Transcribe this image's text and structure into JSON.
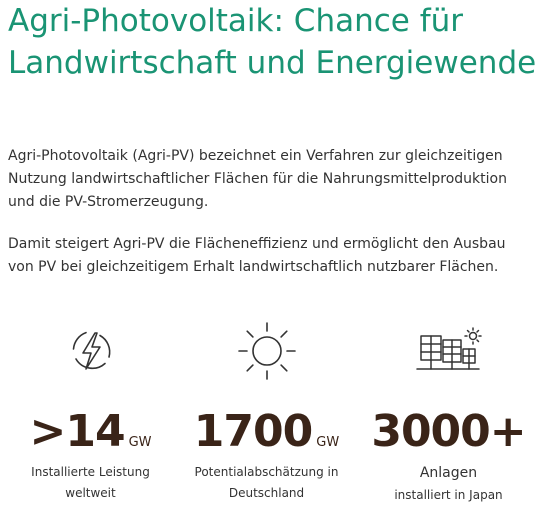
{
  "heading": {
    "title": "Agri-Photovoltaik: Chance für Landwirtschaft und Energiewende"
  },
  "intro": {
    "paragraph1": "Agri-Photovoltaik (Agri-PV) bezeichnet ein Verfahren zur gleichzeitigen Nutzung landwirtschaftlicher Flächen für die Nahrungsmittelproduktion und die PV-Stromerzeugung.",
    "paragraph2": "Damit steigert Agri-PV die Flächeneffizienz und ermöglicht den Ausbau von PV bei gleichzeitigem Erhalt landwirtschaftlich nutzbarer Flächen."
  },
  "stats": [
    {
      "icon": "lightning-circle-icon",
      "value": ">14",
      "unit": "GW",
      "caption_line1": "Installierte Leistung",
      "caption_line2": "weltweit"
    },
    {
      "icon": "sun-icon",
      "value": "1700",
      "unit": "GW",
      "caption_line1": "Potentialabschätzung in",
      "caption_line2": "Deutschland"
    },
    {
      "icon": "solar-panels-sun-icon",
      "value": "3000+",
      "unit": "",
      "caption_line1": "Anlagen",
      "caption_line2": "installiert in Japan"
    }
  ],
  "colors": {
    "title": "#1a9474",
    "figure": "#3a2418",
    "text": "#333333",
    "icon": "#333333"
  }
}
